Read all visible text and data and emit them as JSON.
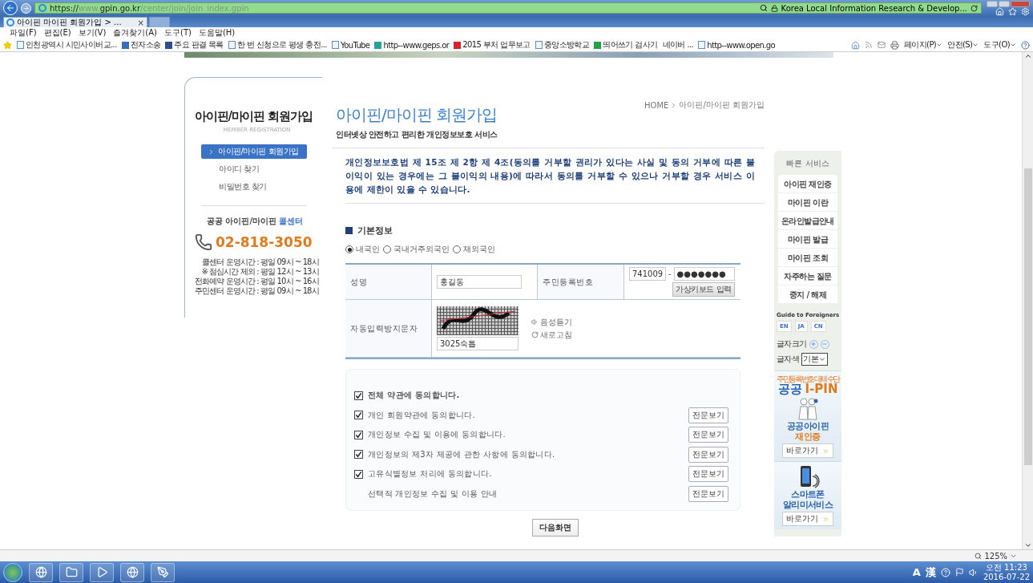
{
  "browser": {
    "url_scheme": "https://",
    "url_host": "www.gpin.go.kr",
    "url_path": "/center/join/join_index.gpin",
    "site_identity": "Korea Local Information Research & Develop...",
    "tab_title": "아이핀 마이핀 회원가입 > ...",
    "tab_close": "×"
  },
  "menu_bar": [
    "파일(F)",
    "편집(E)",
    "보기(V)",
    "즐겨찾기(A)",
    "도구(T)",
    "도움말(H)"
  ],
  "favorites": [
    {
      "label": "인천광역시 시민사이버교...",
      "kind": "page"
    },
    {
      "label": "전자소송",
      "kind": "mark",
      "color": "#3a6fb8"
    },
    {
      "label": "주요 판결 목록",
      "kind": "mark",
      "color": "#2d4f8f"
    },
    {
      "label": "한 번 신청으로 평생 충전...",
      "kind": "page"
    },
    {
      "label": "YouTube",
      "kind": "page"
    },
    {
      "label": "http--www.geps.or",
      "kind": "mark",
      "color": "#2aa198"
    },
    {
      "label": "2015 부처 업무보고",
      "kind": "mark",
      "color": "#d6232a"
    },
    {
      "label": "중앙소방학교",
      "kind": "page"
    },
    {
      "label": "띄어쓰기 검사기",
      "kind": "mark",
      "color": "#24a148"
    },
    {
      "label": "네이버 ...",
      "kind": "none"
    },
    {
      "label": "http--www.open.go",
      "kind": "page"
    }
  ],
  "command_bar": [
    "페이지(P)",
    "안전(S)",
    "도구(O)"
  ],
  "page": {
    "side": {
      "title": "아이핀/마이핀 회원가입",
      "subtitle": "MEMBER REGISTRATION",
      "nav": [
        {
          "label": "아이핀/마이핀 회원가입",
          "selected": true
        },
        {
          "label": "아이디 찾기",
          "selected": false
        },
        {
          "label": "비밀번호 찾기",
          "selected": false
        }
      ],
      "call_center": {
        "heading": "공공 아이핀/마이핀",
        "heading_accent": "콜센터",
        "phone": "02-818-3050",
        "hours": [
          "콜센터 운영시간 : 평일 09시 ~ 18시",
          "※ 점심시간 제외 : 평일 12시 ~ 13시",
          "전화예약 운영시간 : 평일 10시 ~ 16시",
          "주민센터 운영시간 : 평일 09시 ~ 18시"
        ]
      }
    },
    "breadcrumb": [
      "HOME",
      "아이핀/마이핀 회원가입"
    ],
    "title": "아이핀/마이핀 회원가입",
    "subtitle": "인터넷상 안전하고 편리한 개인정보보호 서비스",
    "notice": "개인정보보호법 제 15조 제 2항 제 4조(동의를 거부할 권리가 있다는 사실 및 동의 거부에 따른 불이익이 있는 경우에는 그 불이익의 내용)에 따라서 동의를 거부할 수 있으나 거부할 경우 서비스 이용에 제한이 있을 수 있습니다.",
    "section": "기본정보",
    "nationality": [
      {
        "label": "내국인",
        "selected": true
      },
      {
        "label": "국내거주외국인",
        "selected": false
      },
      {
        "label": "재외국인",
        "selected": false
      }
    ],
    "form": {
      "name_label": "성명",
      "name_value": "홍길동",
      "rrn_label": "주민등록번호",
      "rrn_front": "741009",
      "rrn_dash": "-",
      "rrn_back": "●●●●●●●",
      "keyboard_button": "가상키보드 입력",
      "captcha_label": "자동입력방지문자",
      "captcha_audio": "음성듣기",
      "captcha_refresh": "새로고침",
      "captcha_value": "3025숙톱"
    },
    "agreements": [
      {
        "kind": "all",
        "label": "전체 약관에 동의합니다.",
        "checked": true
      },
      {
        "kind": "item",
        "label": "개인 회원약관에 동의합니다.",
        "checked": true,
        "view_button": "전문보기"
      },
      {
        "kind": "item",
        "label": "개인정보 수집 및 이용에 동의합니다.",
        "checked": true,
        "view_button": "전문보기"
      },
      {
        "kind": "item",
        "label": "개인정보의 제3자 제공에 관한 사항에 동의합니다.",
        "checked": true,
        "view_button": "전문보기"
      },
      {
        "kind": "item",
        "label": "고유식별정보 처리에 동의합니다.",
        "checked": true,
        "view_button": "전문보기"
      },
      {
        "kind": "info",
        "label": "선택적 개인정보 수집 및 이용 안내",
        "view_button": "전문보기"
      }
    ],
    "next_button": "다음화면"
  },
  "quick": {
    "title": "빠른 서비스",
    "items": [
      "아이핀 재인증",
      "마이핀 이란",
      "온라인발급안내",
      "마이핀 발급",
      "마이핀 조회",
      "자주하는 질문",
      "중지 / 해제"
    ],
    "guide_title": "Guide to Foreigners",
    "languages": [
      "EN",
      "JA",
      "CN"
    ],
    "font_size_label": "글자크기",
    "font_color_label": "글자색",
    "font_color_value": "기본"
  },
  "banners": [
    {
      "kind": "ipin",
      "tagline": "주민등록번호 대체 수단",
      "brand": "공공",
      "brand_accent": "I-PIN",
      "line1": "공공아이핀",
      "line2": "재인증",
      "link": "바로가기"
    },
    {
      "kind": "phone",
      "line1": "스마트폰",
      "line2": "알리미서비스",
      "link": "바로가기"
    }
  ],
  "status_bar": {
    "zoom": "125%"
  },
  "taskbar": {
    "ime_mode": "A",
    "ime_hanja": "漢",
    "time": "오전 11:23",
    "date": "2016-07-22"
  }
}
